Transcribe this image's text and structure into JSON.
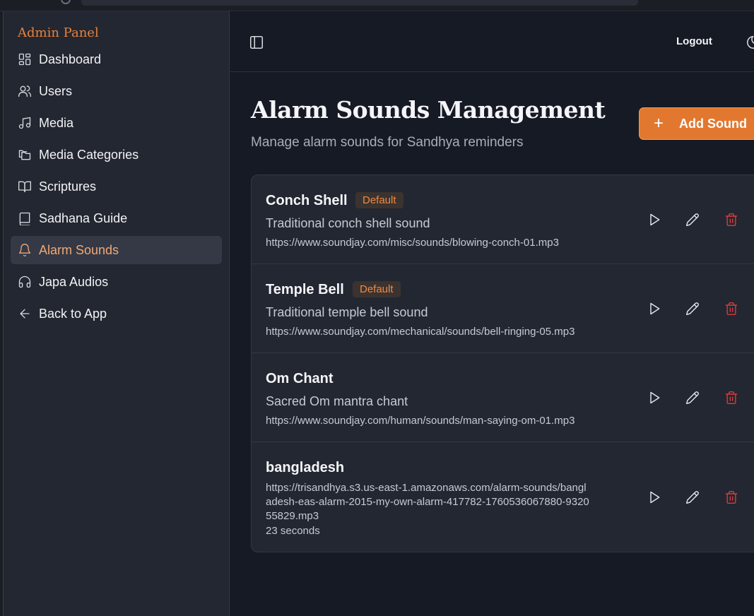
{
  "sidebar": {
    "brand": "Admin Panel",
    "items": [
      {
        "label": "Dashboard",
        "icon": "dashboard-icon"
      },
      {
        "label": "Users",
        "icon": "users-icon"
      },
      {
        "label": "Media",
        "icon": "music-icon"
      },
      {
        "label": "Media Categories",
        "icon": "folders-icon"
      },
      {
        "label": "Scriptures",
        "icon": "book-open-icon"
      },
      {
        "label": "Sadhana Guide",
        "icon": "book-icon"
      },
      {
        "label": "Alarm Sounds",
        "icon": "bell-icon",
        "active": true
      },
      {
        "label": "Japa Audios",
        "icon": "headphones-icon"
      },
      {
        "label": "Back to App",
        "icon": "arrow-left-icon"
      }
    ]
  },
  "topbar": {
    "logout_label": "Logout"
  },
  "page": {
    "title": "Alarm Sounds Management",
    "subtitle": "Manage alarm sounds for Sandhya reminders",
    "add_button_label": "Add Sound"
  },
  "sounds": [
    {
      "name": "Conch Shell",
      "badge": "Default",
      "description": "Traditional conch shell sound",
      "url": "https://www.soundjay.com/misc/sounds/blowing-conch-01.mp3"
    },
    {
      "name": "Temple Bell",
      "badge": "Default",
      "description": "Traditional temple bell sound",
      "url": "https://www.soundjay.com/mechanical/sounds/bell-ringing-05.mp3"
    },
    {
      "name": "Om Chant",
      "description": "Sacred Om mantra chant",
      "url": "https://www.soundjay.com/human/sounds/man-saying-om-01.mp3"
    },
    {
      "name": "bangladesh",
      "url": "https://trisandhya.s3.us-east-1.amazonaws.com/alarm-sounds/bangladesh-eas-alarm-2015-my-own-alarm-417782-1760536067880-932055829.mp3",
      "duration": "23 seconds"
    }
  ],
  "colors": {
    "accent": "#e2782f",
    "active_text": "#f0a878",
    "delete": "#d93b3b",
    "background": "#161a24",
    "surface": "#232731"
  }
}
